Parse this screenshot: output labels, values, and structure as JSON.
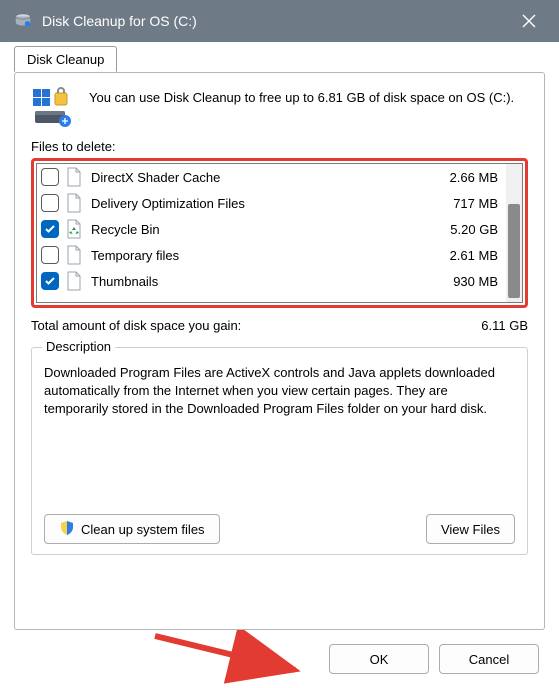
{
  "window": {
    "title": "Disk Cleanup for OS (C:)"
  },
  "tab": {
    "label": "Disk Cleanup"
  },
  "intro": {
    "text": "You can use Disk Cleanup to free up to 6.81 GB of disk space on OS (C:)."
  },
  "files": {
    "label": "Files to delete:",
    "items": [
      {
        "name": "DirectX Shader Cache",
        "size": "2.66 MB",
        "checked": false,
        "icon": "page"
      },
      {
        "name": "Delivery Optimization Files",
        "size": "717 MB",
        "checked": false,
        "icon": "page"
      },
      {
        "name": "Recycle Bin",
        "size": "5.20 GB",
        "checked": true,
        "icon": "recycle"
      },
      {
        "name": "Temporary files",
        "size": "2.61 MB",
        "checked": false,
        "icon": "page"
      },
      {
        "name": "Thumbnails",
        "size": "930 MB",
        "checked": true,
        "icon": "page"
      }
    ]
  },
  "total": {
    "label": "Total amount of disk space you gain:",
    "value": "6.11 GB"
  },
  "description": {
    "legend": "Description",
    "body": "Downloaded Program Files are ActiveX controls and Java applets downloaded automatically from the Internet when you view certain pages. They are temporarily stored in the Downloaded Program Files folder on your hard disk."
  },
  "buttons": {
    "cleanup_system": "Clean up system files",
    "view_files": "View Files",
    "ok": "OK",
    "cancel": "Cancel"
  }
}
